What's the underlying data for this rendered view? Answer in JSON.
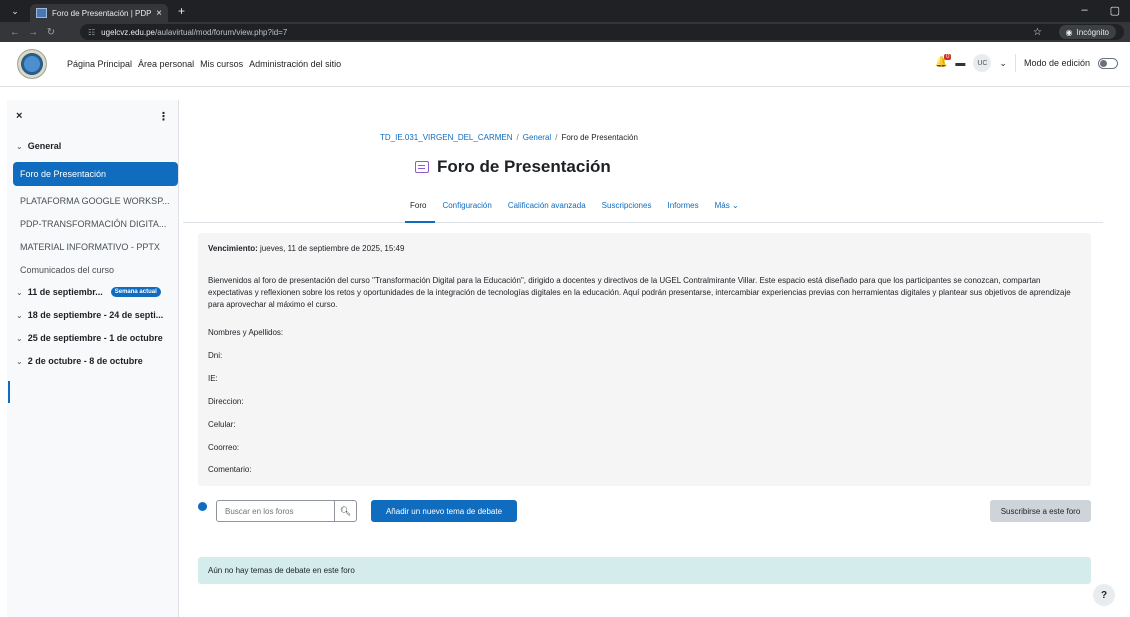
{
  "browser": {
    "tab_title": "Foro de Presentación | PDP",
    "url_host": "ugelcvz.edu.pe",
    "url_path": "/aulavirtual/mod/forum/view.php?id=7",
    "incognito_label": "Incógnito"
  },
  "navbar": {
    "items": [
      "Página Principal",
      "Área personal",
      "Mis cursos",
      "Administración del sitio"
    ],
    "notification_count": "0",
    "user_initials": "UC",
    "edit_mode_label": "Modo de edición"
  },
  "drawer": {
    "section_general": "General",
    "items": [
      "Foro de Presentación",
      "PLATAFORMA GOOGLE WORKSP...",
      "PDP-TRANSFORMACIÓN DIGITA...",
      "MATERIAL INFORMATIVO - PPTX",
      "Comunicados del curso"
    ],
    "sections": [
      "11 de septiembr...",
      "18 de septiembre - 24 de septi...",
      "25 de septiembre - 1 de octubre",
      "2 de octubre - 8 de octubre"
    ],
    "current_badge": "Semana actual"
  },
  "breadcrumb": [
    "TD_IE.031_VIRGEN_DEL_CARMEN",
    "General",
    "Foro de Presentación"
  ],
  "page_title": "Foro de Presentación",
  "tabs": [
    "Foro",
    "Configuración",
    "Calificación avanzada",
    "Suscripciones",
    "Informes",
    "Más"
  ],
  "info": {
    "due_label": "Vencimiento:",
    "due_value": "jueves, 11 de septiembre de 2025, 15:49",
    "intro": "Bienvenidos al foro de presentación del curso \"Transformación Digital para la Educación\", dirigido a docentes y directivos de la UGEL Contralmirante Villar. Este espacio está diseñado para que los participantes se conozcan, compartan expectativas y reflexionen sobre los retos y oportunidades de la integración de tecnologías digitales en la educación. Aquí podrán presentarse, intercambiar experiencias previas con herramientas digitales y plantear sus objetivos de aprendizaje para aprovechar al máximo el curso.",
    "fields": [
      "Nombres y Apellidos:",
      "Dni:",
      "IE:",
      "Direccion:",
      "Celular:",
      "Coorreo:",
      "Comentario:"
    ]
  },
  "search": {
    "placeholder": "Buscar en los foros"
  },
  "buttons": {
    "add_topic": "Añadir un nuevo tema de debate",
    "subscribe": "Suscribirse a este foro"
  },
  "empty_notice": "Aún no hay temas de debate en este foro",
  "help_button": "?"
}
